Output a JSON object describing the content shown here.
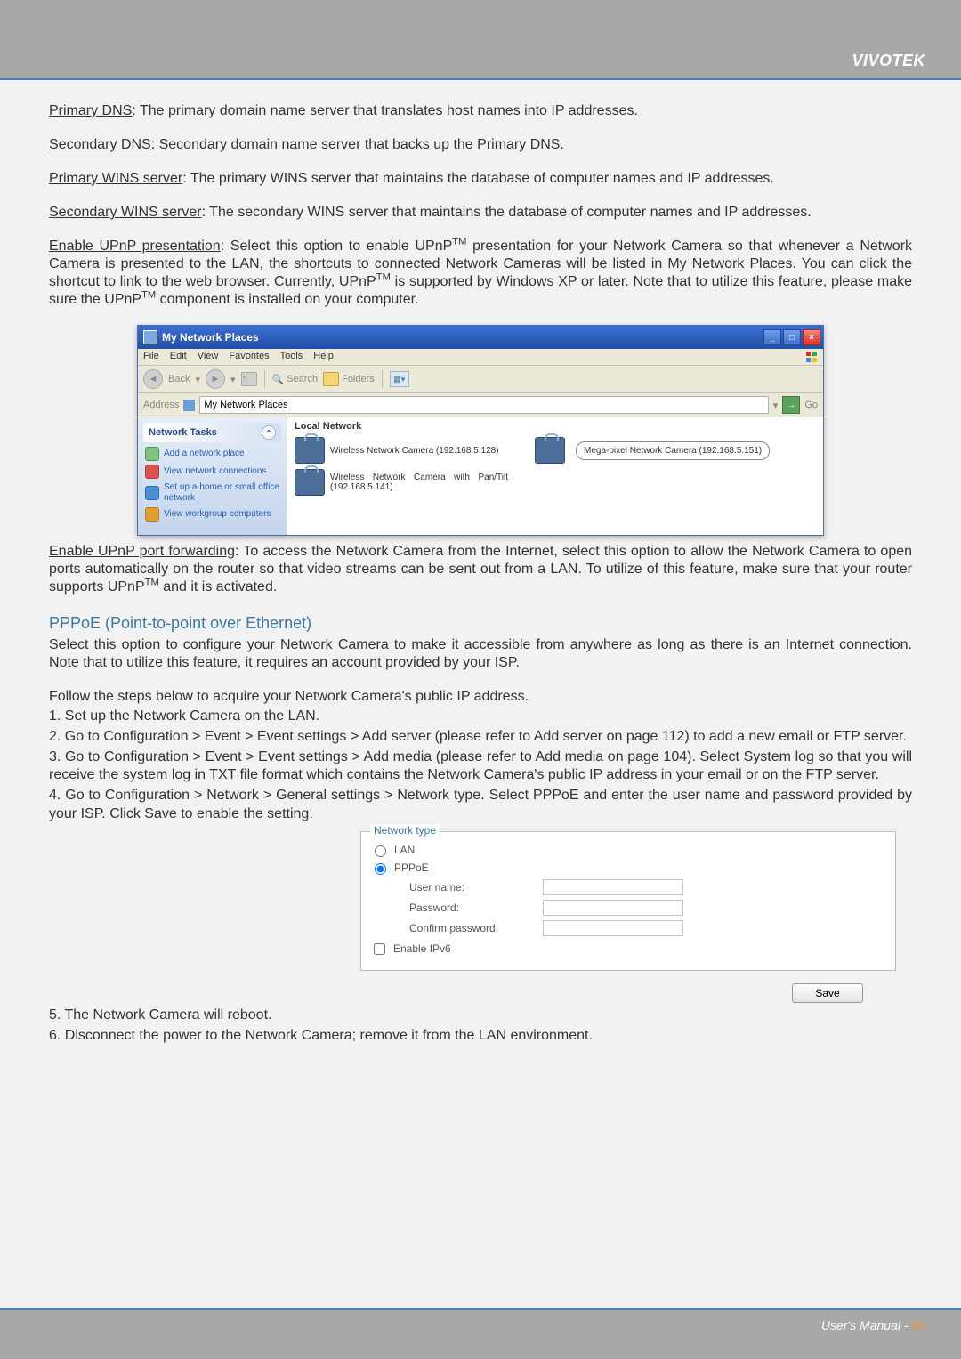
{
  "brand": "VIVOTEK",
  "footer_label": "User's Manual - ",
  "page_number": "69",
  "paragraphs": {
    "primary_dns_label": "Primary DNS",
    "primary_dns_text": ": The primary domain name server that translates host names into IP addresses.",
    "secondary_dns_label": "Secondary DNS",
    "secondary_dns_text": ": Secondary domain name server that backs up the Primary DNS.",
    "primary_wins_label": "Primary WINS server",
    "primary_wins_text": ": The primary WINS server that maintains the database of computer names and IP addresses.",
    "secondary_wins_label": "Secondary WINS server",
    "secondary_wins_text": ": The secondary WINS server that maintains the database of computer names and IP addresses.",
    "upnp_pres_label": "Enable UPnP presentation",
    "upnp_pres_text": ": Select this option to enable UPnP",
    "upnp_pres_text2": " presentation for your Network Camera so that whenever a Network Camera is presented to the LAN, the shortcuts to connected Network Cameras will be listed in My Network Places. You can click the shortcut to link to the web browser. Currently, UPnP",
    "upnp_pres_text3": " is supported by Windows XP or later. Note that to utilize this feature, please make sure the UPnP",
    "upnp_pres_text4": " component is installed on your computer.",
    "upnp_fwd_label": "Enable UPnP port forwarding",
    "upnp_fwd_text": ": To access the Network Camera from the Internet, select this option to allow the Network Camera to open ports automatically on the router so that video streams can be sent out from a LAN. To utilize of this feature, make sure that your router supports UPnP",
    "upnp_fwd_text2": " and it is activated."
  },
  "pppoe": {
    "title": "PPPoE (Point-to-point over Ethernet)",
    "intro": "Select this option to configure your Network Camera to make it accessible from anywhere as long as there is an Internet connection. Note that to utilize this feature, it requires an account provided by your ISP.",
    "follow": "Follow the steps below to acquire your Network Camera's public IP address.",
    "steps": [
      "1. Set up the Network Camera on the LAN.",
      "2. Go to Configuration > Event > Event settings > Add server (please refer to Add server on page 112) to add a new email or FTP server.",
      "3. Go to Configuration > Event > Event settings > Add media (please refer to Add media on page 104). Select System log so that you will receive the system log in TXT file format which contains the Network Camera's public IP address in your email or on the FTP server.",
      "4. Go to Configuration > Network > General settings > Network type. Select PPPoE and enter the user name and password provided by your ISP. Click Save to enable the setting."
    ],
    "after_steps": [
      "5. The Network Camera will reboot.",
      "6. Disconnect the power to the Network Camera; remove it from the LAN environment."
    ]
  },
  "xp": {
    "title": "My Network Places",
    "menu": [
      "File",
      "Edit",
      "View",
      "Favorites",
      "Tools",
      "Help"
    ],
    "back": "Back",
    "search": "Search",
    "folders": "Folders",
    "address_label": "Address",
    "address_value": "My Network Places",
    "go": "Go",
    "tasks_head": "Network Tasks",
    "tasks": [
      "Add a network place",
      "View network connections",
      "Set up a home or small office network",
      "View workgroup computers"
    ],
    "main_head": "Local Network",
    "cam1": "Wireless Network Camera (192.168.5.128)",
    "cam2": "Wireless Network Camera with Pan/Tilt (192.168.5.141)",
    "callout": "Mega-pixel Network Camera (192.168.5.151)"
  },
  "netform": {
    "legend": "Network type",
    "lan": "LAN",
    "pppoe": "PPPoE",
    "username": "User name:",
    "password": "Password:",
    "confirm": "Confirm password:",
    "ipv6": "Enable IPv6",
    "save": "Save"
  }
}
